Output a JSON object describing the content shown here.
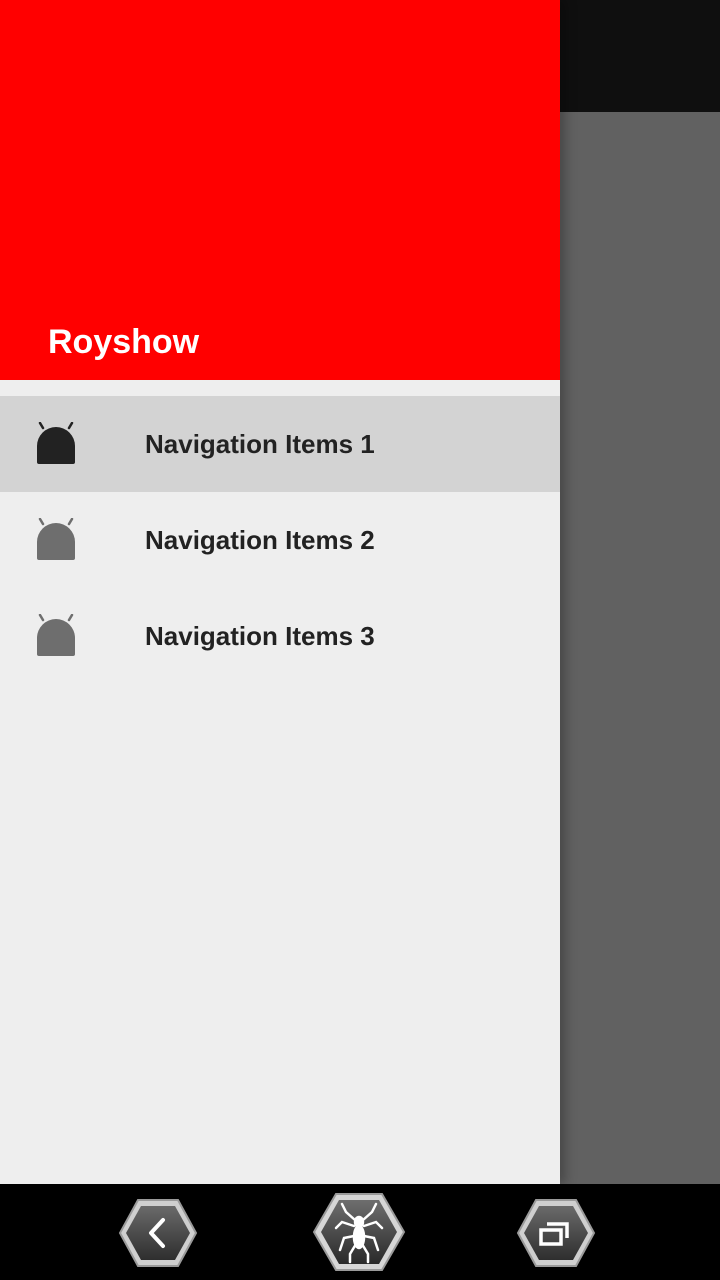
{
  "drawer": {
    "header": {
      "title": "Royshow",
      "color": "#ff0000"
    },
    "items": [
      {
        "label": "Navigation Items 1",
        "icon": "android-icon",
        "selected": true
      },
      {
        "label": "Navigation Items 2",
        "icon": "android-icon",
        "selected": false
      },
      {
        "label": "Navigation Items 3",
        "icon": "android-icon",
        "selected": false
      }
    ]
  },
  "system_nav": {
    "buttons": [
      "back-icon",
      "spider-home-icon",
      "recent-apps-icon"
    ]
  },
  "colors": {
    "header": "#ff0000",
    "drawer_bg": "#eeeeee",
    "selected_item_bg": "#d3d3d3",
    "scrim": "#616161",
    "selected_icon": "#222222",
    "unselected_icon": "#6e6e6e"
  }
}
